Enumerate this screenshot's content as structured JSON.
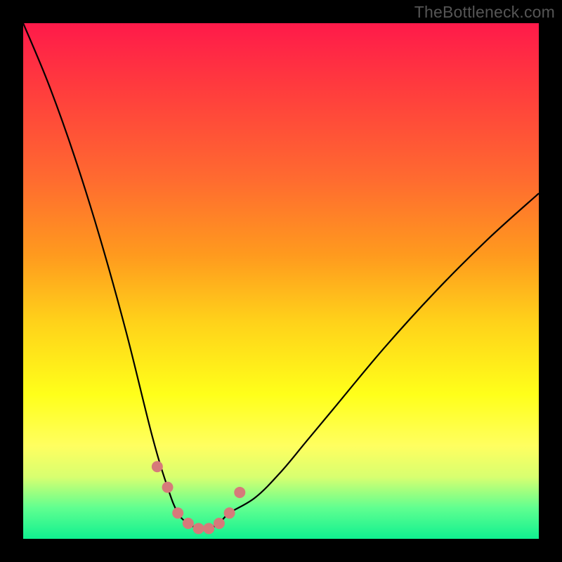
{
  "watermark": "TheBottleneck.com",
  "chart_data": {
    "type": "line",
    "title": "",
    "xlabel": "",
    "ylabel": "",
    "xlim": [
      0,
      100
    ],
    "ylim": [
      0,
      100
    ],
    "series": [
      {
        "name": "bottleneck-curve",
        "color": "#000000",
        "x": [
          0,
          5,
          10,
          15,
          20,
          25,
          28,
          30,
          32,
          34,
          36,
          38,
          40,
          45,
          50,
          55,
          60,
          70,
          80,
          90,
          100
        ],
        "values": [
          100,
          88,
          74,
          58,
          40,
          20,
          10,
          5,
          3,
          2,
          2,
          3,
          5,
          8,
          13,
          19,
          25,
          37,
          48,
          58,
          67
        ]
      }
    ],
    "markers": {
      "name": "highlight-points",
      "color": "#d67a7a",
      "radius_px": 8,
      "x": [
        26,
        28,
        30,
        32,
        34,
        36,
        38,
        40,
        42
      ],
      "values": [
        14,
        10,
        5,
        3,
        2,
        2,
        3,
        5,
        9
      ]
    },
    "background_gradient": {
      "top": "#ff1a4a",
      "mid": "#ffff1a",
      "bottom": "#10f090"
    }
  }
}
